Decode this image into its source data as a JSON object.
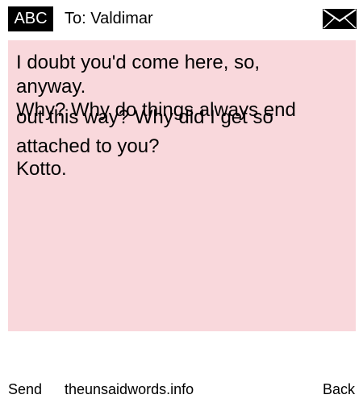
{
  "header": {
    "input_mode": "ABC",
    "recipient": "To: Valdimar",
    "envelope_icon": "envelope-icon"
  },
  "message": {
    "lines": [
      "I doubt you'd come here, so,",
      "anyway.",
      "Why? Why do things always end",
      "out this way? Why did I get so",
      "attached to you?",
      "Kotto."
    ],
    "background_color": "#f9d8dc"
  },
  "footer": {
    "send_label": "Send",
    "site_label": "theunsaidwords.info",
    "back_label": "Back"
  }
}
